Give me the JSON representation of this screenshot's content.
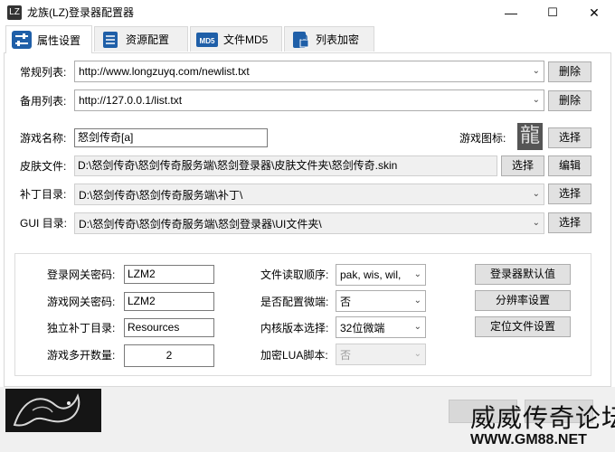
{
  "window": {
    "title": "龙族(LZ)登录器配置器",
    "icon_text": "LZ",
    "minimize": "—",
    "maximize": "☐",
    "close": "✕"
  },
  "tabs": [
    {
      "label": "属性设置",
      "icon": "sliders-icon"
    },
    {
      "label": "资源配置",
      "icon": "database-icon"
    },
    {
      "label": "文件MD5",
      "icon": "md5-icon",
      "icon_text": "MD5"
    },
    {
      "label": "列表加密",
      "icon": "lock-file-icon"
    }
  ],
  "form": {
    "normal_list": {
      "label": "常规列表:",
      "value": "http://www.longzuyq.com/newlist.txt",
      "button": "删除"
    },
    "backup_list": {
      "label": "备用列表:",
      "value": "http://127.0.0.1/list.txt",
      "button": "删除"
    },
    "game_name": {
      "label": "游戏名称:",
      "value": "怒剑传奇[a]"
    },
    "game_icon": {
      "label": "游戏图标:",
      "glyph": "龍",
      "button": "选择"
    },
    "skin_file": {
      "label": "皮肤文件:",
      "value": "D:\\怒剑传奇\\怒剑传奇服务端\\怒剑登录器\\皮肤文件夹\\怒剑传奇.skin",
      "button_select": "选择",
      "button_edit": "编辑"
    },
    "patch_dir": {
      "label": "补丁目录:",
      "value": "D:\\怒剑传奇\\怒剑传奇服务端\\补丁\\",
      "button": "选择"
    },
    "gui_dir": {
      "label": "GUI 目录:",
      "value": "D:\\怒剑传奇\\怒剑传奇服务端\\怒剑登录器\\UI文件夹\\",
      "button": "选择"
    }
  },
  "group": {
    "login_pwd": {
      "label": "登录网关密码:",
      "value": "LZM2"
    },
    "game_pwd": {
      "label": "游戏网关密码:",
      "value": "LZM2"
    },
    "patch_dir": {
      "label": "独立补丁目录:",
      "value": "Resources"
    },
    "multi_open": {
      "label": "游戏多开数量:",
      "value": "2"
    },
    "read_order": {
      "label": "文件读取顺序:",
      "value": "pak, wis, wil,"
    },
    "micro_client": {
      "label": "是否配置微端:",
      "value": "否"
    },
    "kernel": {
      "label": "内核版本选择:",
      "value": "32位微端"
    },
    "lua_encrypt": {
      "label": "加密LUA脚本:",
      "value": "否"
    },
    "btn_default": "登录器默认值",
    "btn_resolution": "分辨率设置",
    "btn_locate": "定位文件设置"
  },
  "watermark": {
    "line1": "威威传奇论坛",
    "line2": "WWW.GM88.NET"
  }
}
